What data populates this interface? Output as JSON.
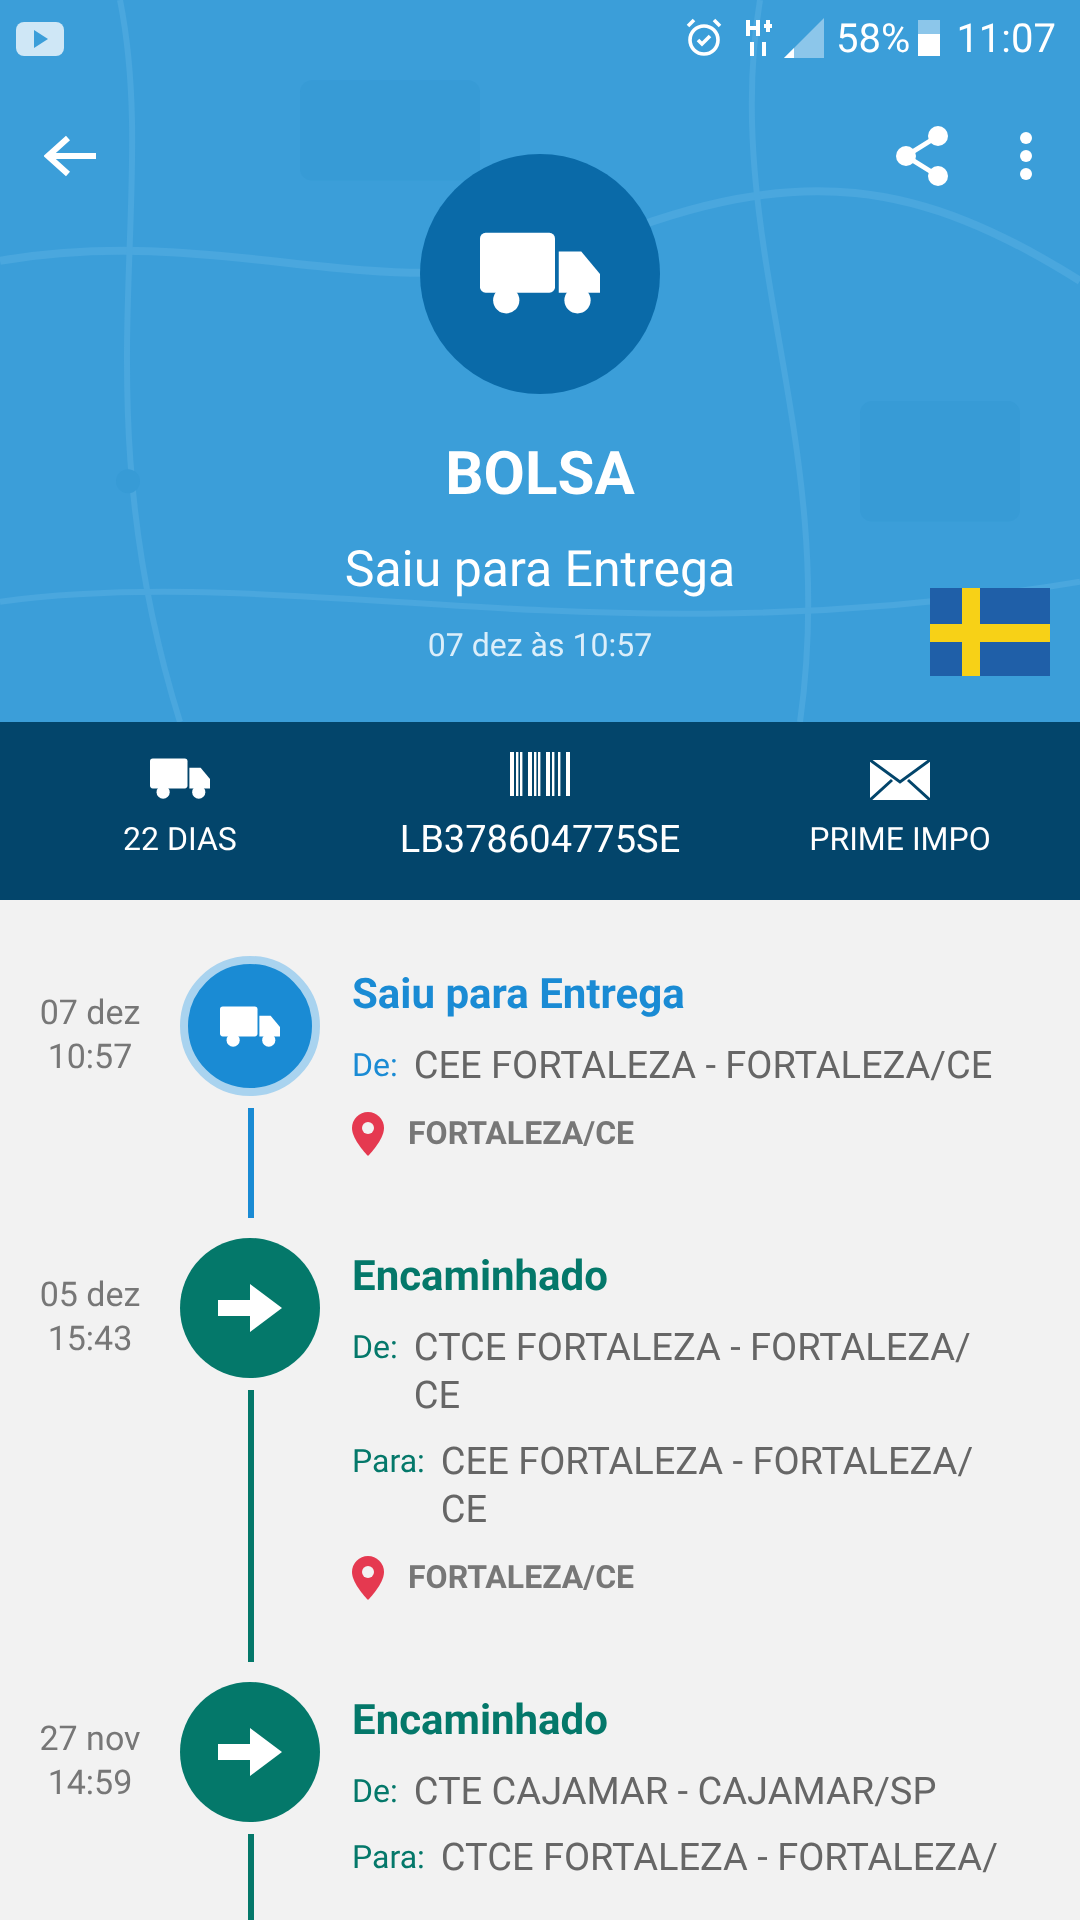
{
  "status_bar": {
    "battery": "58%",
    "time": "11:07"
  },
  "header": {
    "title": "BOLSA",
    "status": "Saiu para Entrega",
    "date": "07 dez às 10:57"
  },
  "info_bar": [
    {
      "kind": "days",
      "label": "22 DIAS"
    },
    {
      "kind": "code",
      "label": "LB378604775SE"
    },
    {
      "kind": "sender",
      "label": "PRIME IMPO"
    }
  ],
  "events": [
    {
      "kind": "delivery",
      "date": "07 dez",
      "time": "10:57",
      "title": "Saiu para Entrega",
      "rows": [
        {
          "label": "De:",
          "lines": [
            "CEE FORTALEZA - FORTALEZA/CE"
          ]
        }
      ],
      "location": "FORTALEZA/CE"
    },
    {
      "kind": "forwarded",
      "date": "05 dez",
      "time": "15:43",
      "title": "Encaminhado",
      "rows": [
        {
          "label": "De:",
          "lines": [
            "CTCE FORTALEZA - FORTALEZA/",
            "CE"
          ]
        },
        {
          "label": "Para:",
          "lines": [
            "CEE FORTALEZA - FORTALEZA/",
            "CE"
          ]
        }
      ],
      "location": "FORTALEZA/CE"
    },
    {
      "kind": "forwarded",
      "date": "27 nov",
      "time": "14:59",
      "title": "Encaminhado",
      "rows": [
        {
          "label": "De:",
          "lines": [
            "CTE CAJAMAR - CAJAMAR/SP"
          ]
        },
        {
          "label": "Para:",
          "lines": [
            "CTCE FORTALEZA - FORTALEZA/"
          ]
        }
      ]
    }
  ]
}
